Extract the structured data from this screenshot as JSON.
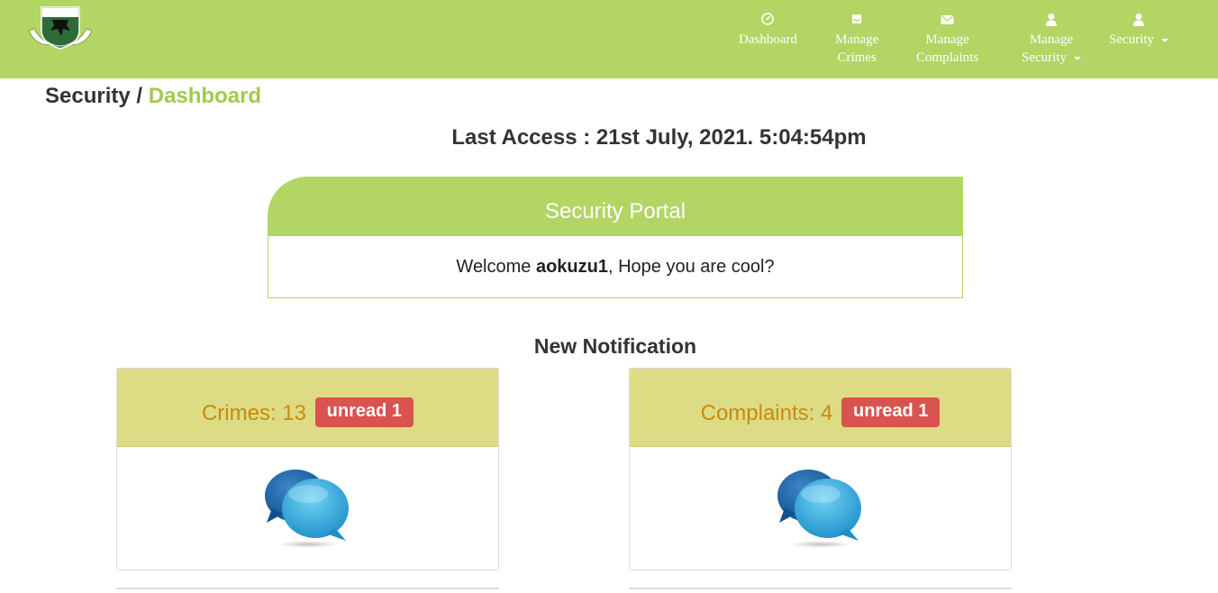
{
  "nav": {
    "items": [
      {
        "label": "Dashboard",
        "icon": "dashboard-icon"
      },
      {
        "label": "Manage\nCrimes",
        "icon": "inbox-icon"
      },
      {
        "label": "Manage\nComplaints",
        "icon": "envelope-icon"
      },
      {
        "label": "Manage\nSecurity",
        "icon": "user-icon"
      },
      {
        "label": "Security",
        "icon": "user-icon"
      }
    ]
  },
  "breadcrumb": {
    "parent": "Security",
    "separator": "/",
    "current": "Dashboard"
  },
  "last_access": "Last Access : 21st July, 2021. 5:04:54pm",
  "portal": {
    "title": "Security Portal",
    "welcome_prefix": "Welcome ",
    "username": "aokuzu1",
    "welcome_suffix": ", Hope you are cool?"
  },
  "notifications": {
    "title": "New Notification",
    "cards": [
      {
        "label": "Crimes: 13",
        "badge": "unread 1",
        "icon": "chat-bubbles-icon"
      },
      {
        "label": "Complaints: 4",
        "badge": "unread 1",
        "icon": "chat-bubbles-icon"
      }
    ]
  },
  "colors": {
    "accent": "#b2d564",
    "card_header": "#dddc85",
    "badge": "#d9534f",
    "card_label": "#c98a10"
  }
}
